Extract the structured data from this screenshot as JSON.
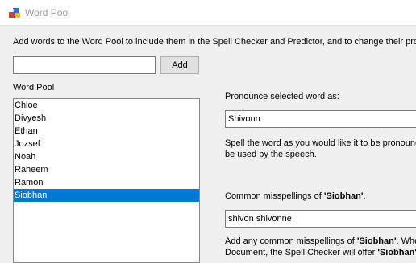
{
  "window": {
    "title": "Word Pool"
  },
  "intro": "Add words to the Word Pool to include them in the Spell Checker and Predictor, and to change their pron",
  "add": {
    "input_value": "",
    "button_label": "Add"
  },
  "pool": {
    "label": "Word Pool",
    "items": [
      "Chloe",
      "Divyesh",
      "Ethan",
      "Jozsef",
      "Noah",
      "Raheem",
      "Ramon",
      "Siobhan"
    ],
    "selected": "Siobhan"
  },
  "pronounce": {
    "label": "Pronounce selected word as:",
    "value": "Shivonn",
    "help_line1": "Spell the word as you would like it to be pronounc",
    "help_line2": "be used by the speech."
  },
  "misspellings": {
    "label_prefix": "Common misspellings of ",
    "word": "'Siobhan'",
    "label_suffix": ".",
    "value": "shivon shivonne",
    "help_line1_prefix": "Add any common misspellings of ",
    "help_line1_word": "'Siobhan'",
    "help_line1_suffix": ". Wher",
    "help_line2_prefix": "Document, the Spell Checker will offer ",
    "help_line2_word": "'Siobhan'"
  },
  "colors": {
    "selection": "#0078d7",
    "window_bg": "#f0f0f0"
  }
}
